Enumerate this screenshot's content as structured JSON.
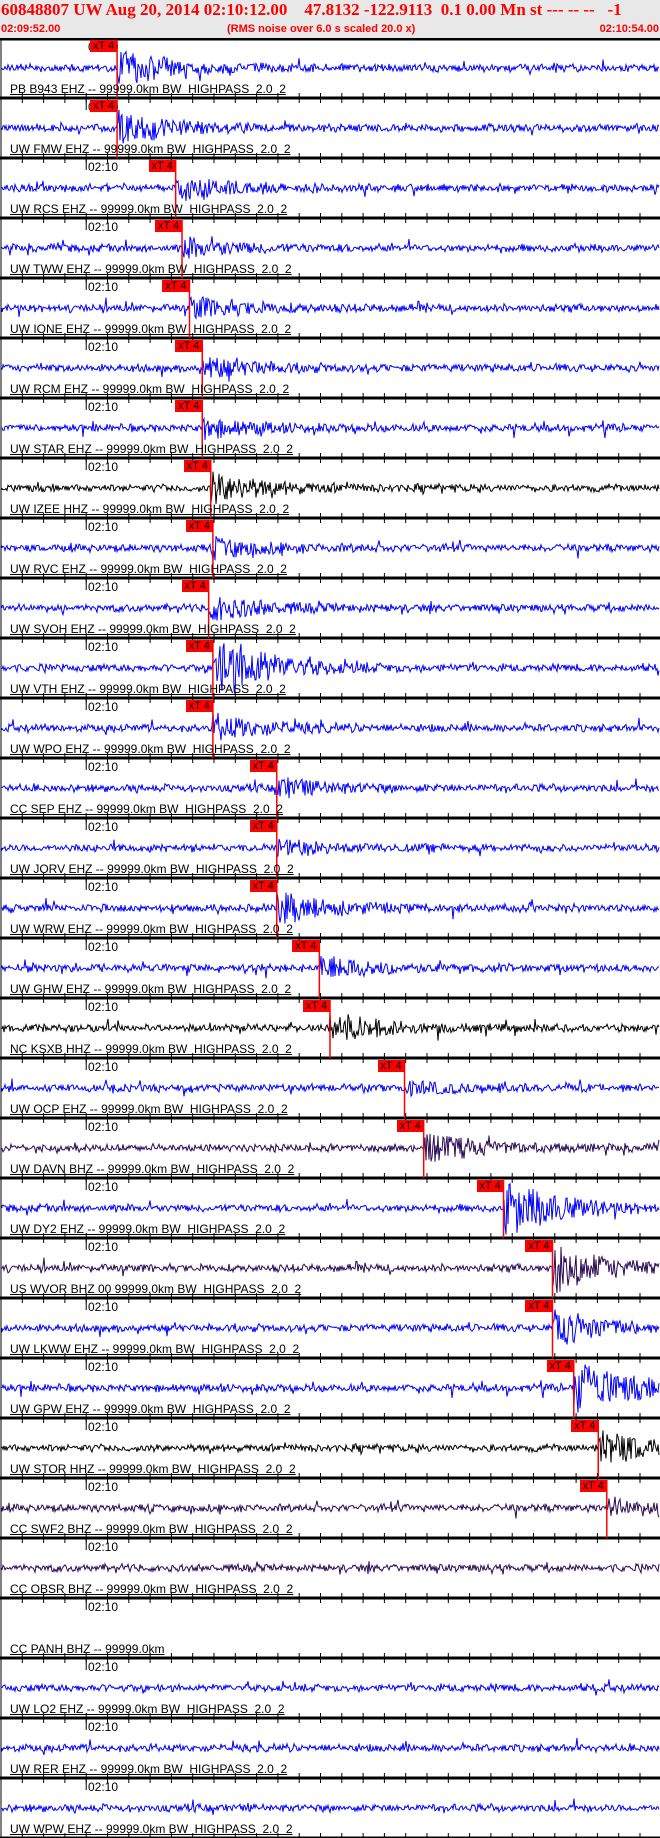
{
  "header": {
    "title": "60848807 UW Aug 20, 2014 02:10:12.00    47.8132 -122.9113  0.1 0.00 Mn st --- -- --   -1",
    "start_time": "02:09:52.00",
    "end_time": "02:10:54.00",
    "note": "(RMS noise over 6.0 s scaled 20.0 x)"
  },
  "chart_data": {
    "type": "line",
    "title": "Seismogram record section",
    "x_range_seconds": [
      0,
      62
    ],
    "tick_label": "02:10",
    "tick_label_offset_s": 8.1,
    "pick_label": "xT 4",
    "colors": {
      "blue": "#0000ff",
      "black": "#000000",
      "purple": "#2a0a55",
      "pick": "#ff0000"
    },
    "traces": [
      {
        "label": "PB B943 EHZ -- 99999.0km BW  HIGHPASS  2.0  2",
        "color": "blue",
        "pick_s": 11.0,
        "event_amp": 3
      },
      {
        "label": "UW FMW EHZ -- 99999.0km BW  HIGHPASS  2.0  2",
        "color": "blue",
        "pick_s": 11.0,
        "event_amp": 2.5
      },
      {
        "label": "UW RCS EHZ -- 99999.0km BW  HIGHPASS  2.0  2",
        "color": "blue",
        "pick_s": 16.5,
        "event_amp": 2
      },
      {
        "label": "UW TWW EHZ -- 99999.0km BW  HIGHPASS  2.0  2",
        "color": "blue",
        "pick_s": 17.1,
        "event_amp": 1.5
      },
      {
        "label": "UW IONE EHZ -- 99999.0km BW  HIGHPASS  2.0  2",
        "color": "blue",
        "pick_s": 17.8,
        "event_amp": 1.8
      },
      {
        "label": "UW RCM EHZ -- 99999.0km BW  HIGHPASS  2.0  2",
        "color": "blue",
        "pick_s": 19.0,
        "event_amp": 1.8
      },
      {
        "label": "UW STAR EHZ -- 99999.0km BW  HIGHPASS  2.0  2",
        "color": "blue",
        "pick_s": 19.0,
        "event_amp": 1.5
      },
      {
        "label": "UW IZEE HHZ -- 99999.0km BW  HIGHPASS  2.0  2",
        "color": "black",
        "pick_s": 19.8,
        "event_amp": 2.5
      },
      {
        "label": "UW RVC EHZ -- 99999.0km BW  HIGHPASS  2.0  2",
        "color": "blue",
        "pick_s": 20.0,
        "event_amp": 1.5
      },
      {
        "label": "UW SVOH EHZ -- 99999.0km BW  HIGHPASS  2.0  2",
        "color": "blue",
        "pick_s": 19.6,
        "event_amp": 2
      },
      {
        "label": "UW VTH EHZ -- 99999.0km BW  HIGHPASS  2.0  2",
        "color": "blue",
        "pick_s": 20.0,
        "event_amp": 6
      },
      {
        "label": "UW WPO EHZ -- 99999.0km BW  HIGHPASS  2.0  2",
        "color": "blue",
        "pick_s": 20.0,
        "event_amp": 2
      },
      {
        "label": "CC SEP EHZ -- 99999.0km BW  HIGHPASS  2.0  2",
        "color": "blue",
        "pick_s": 26.0,
        "event_amp": 1.5
      },
      {
        "label": "UW JORV EHZ -- 99999.0km BW  HIGHPASS  2.0  2",
        "color": "blue",
        "pick_s": 26.0,
        "event_amp": 1.2
      },
      {
        "label": "UW WRW EHZ -- 99999.0km BW  HIGHPASS  2.0  2",
        "color": "blue",
        "pick_s": 26.0,
        "event_amp": 2.5
      },
      {
        "label": "UW GHW EHZ -- 99999.0km BW  HIGHPASS  2.0  2",
        "color": "blue",
        "pick_s": 30.0,
        "event_amp": 2
      },
      {
        "label": "NC KSXB HHZ -- 99999.0km BW  HIGHPASS  2.0  2",
        "color": "black",
        "pick_s": 31.0,
        "event_amp": 2.5
      },
      {
        "label": "UW OCP EHZ -- 99999.0km BW  HIGHPASS  2.0  2",
        "color": "blue",
        "pick_s": 38.0,
        "event_amp": 1
      },
      {
        "label": "UW DAVN BHZ -- 99999.0km BW  HIGHPASS  2.0  2",
        "color": "purple",
        "pick_s": 39.8,
        "event_amp": 2.5
      },
      {
        "label": "UW DY2 EHZ -- 99999.0km BW  HIGHPASS  2.0  2",
        "color": "blue",
        "pick_s": 47.3,
        "event_amp": 5
      },
      {
        "label": "US WVOR BHZ 00 99999.0km BW  HIGHPASS  2.0  2",
        "color": "purple",
        "pick_s": 51.9,
        "event_amp": 4
      },
      {
        "label": "UW LKWW EHZ -- 99999.0km BW  HIGHPASS  2.0  2",
        "color": "blue",
        "pick_s": 51.9,
        "event_amp": 3
      },
      {
        "label": "UW GPW EHZ -- 99999.0km BW  HIGHPASS  2.0  2",
        "color": "blue",
        "pick_s": 53.9,
        "event_amp": 5
      },
      {
        "label": "UW STOR HHZ -- 99999.0km BW  HIGHPASS  2.0  2",
        "color": "black",
        "pick_s": 56.2,
        "event_amp": 3
      },
      {
        "label": "CC SWF2 BHZ -- 99999.0km BW  HIGHPASS  2.0  2",
        "color": "purple",
        "pick_s": 57.0,
        "event_amp": 1.5
      },
      {
        "label": "CC OBSR BHZ -- 99999.0km BW  HIGHPASS  2.0  2",
        "color": "purple",
        "pick_s": null,
        "event_amp": 1
      },
      {
        "label": "CC PANH BHZ -- 99999.0km",
        "color": "none",
        "pick_s": null,
        "event_amp": 0
      },
      {
        "label": "UW LO2 EHZ -- 99999.0km BW  HIGHPASS  2.0  2",
        "color": "blue",
        "pick_s": null,
        "event_amp": 1
      },
      {
        "label": "UW RER EHZ -- 99999.0km BW  HIGHPASS  2.0  2",
        "color": "blue",
        "pick_s": null,
        "event_amp": 1
      },
      {
        "label": "UW WPW EHZ -- 99999.0km BW  HIGHPASS  2.0  2",
        "color": "blue",
        "pick_s": null,
        "event_amp": 1
      }
    ]
  }
}
